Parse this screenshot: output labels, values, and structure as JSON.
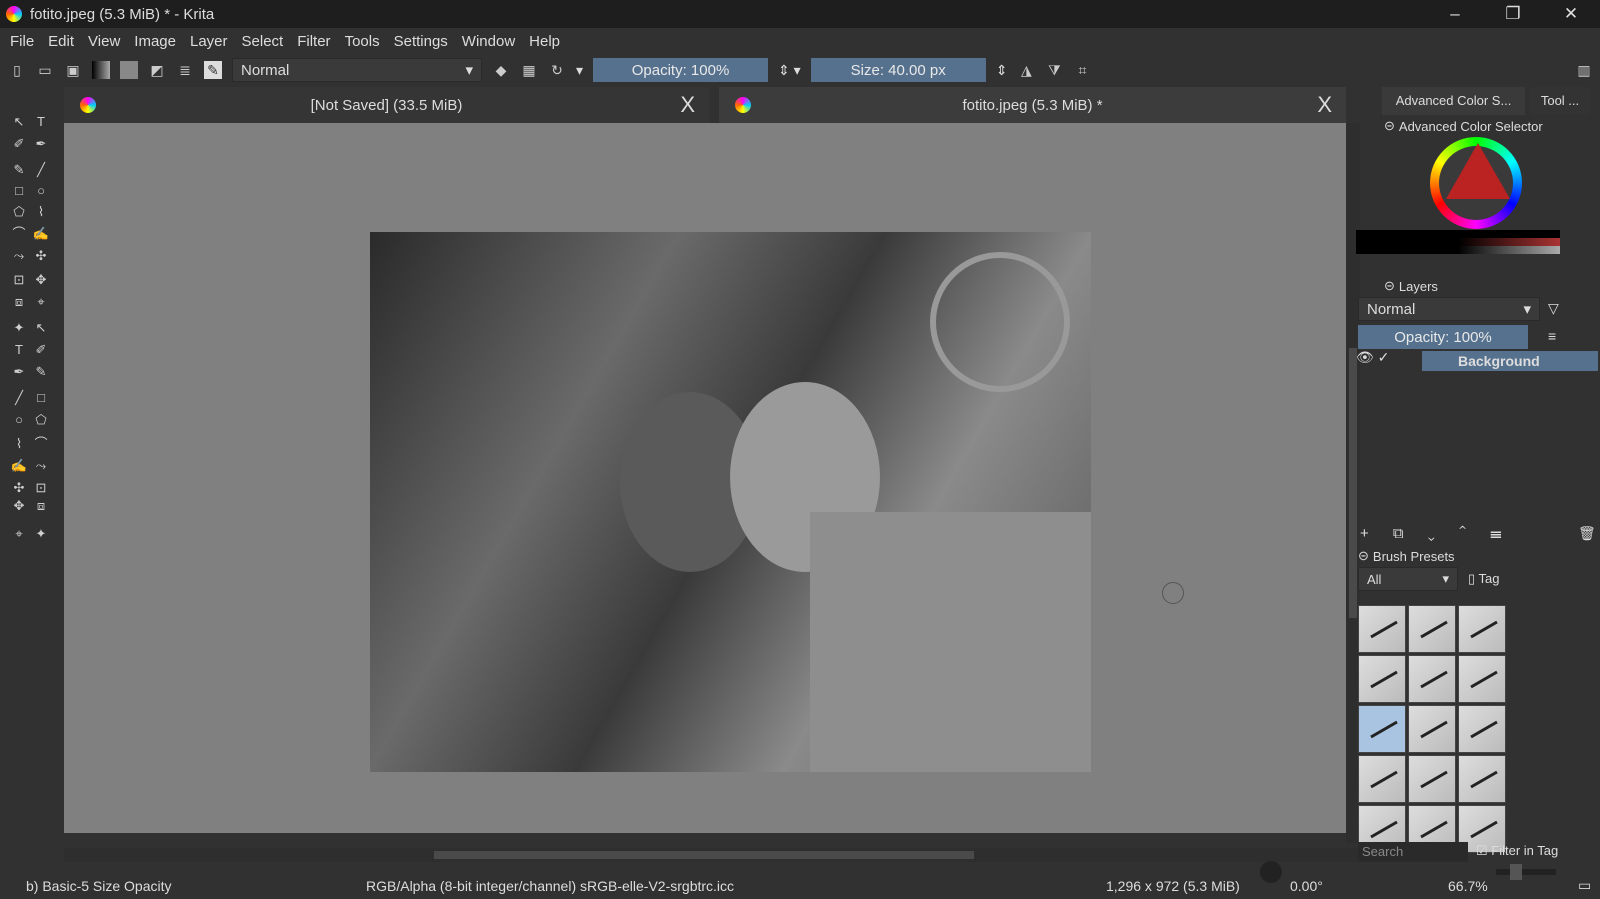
{
  "window": {
    "title": "fotito.jpeg (5.3 MiB) * - Krita",
    "min": "–",
    "max": "❐",
    "close": "✕"
  },
  "menu": [
    "File",
    "Edit",
    "View",
    "Image",
    "Layer",
    "Select",
    "Filter",
    "Tools",
    "Settings",
    "Window",
    "Help"
  ],
  "toolbar": {
    "blend_mode": "Normal",
    "opacity": "Opacity: 100%",
    "size": "Size: 40.00 px"
  },
  "tabs": [
    {
      "label": "[Not Saved]  (33.5 MiB)",
      "close": "X"
    },
    {
      "label": "fotito.jpeg (5.3 MiB) *",
      "close": "X"
    }
  ],
  "right": {
    "tabs": [
      "Advanced Color S...",
      "Tool ..."
    ],
    "color_selector_title": "Advanced Color Selector",
    "layers_title": "Layers",
    "layers_blend": "Normal",
    "layers_opacity": "Opacity:  100%",
    "layer_name": "Background",
    "brush_presets_title": "Brush Presets",
    "brush_filter": "All",
    "tag_label": "Tag",
    "search_placeholder": "Search",
    "filter_in_tag": "Filter in Tag"
  },
  "status": {
    "brush": "b) Basic-5 Size Opacity",
    "color_space": "RGB/Alpha (8-bit integer/channel)  sRGB-elle-V2-srgbtrc.icc",
    "dimensions": "1,296 x 972 (5.3 MiB)",
    "rotation": "0.00°",
    "zoom": "66.7%"
  },
  "colors": {
    "accent": "#56718e",
    "canvas": "#808080"
  }
}
